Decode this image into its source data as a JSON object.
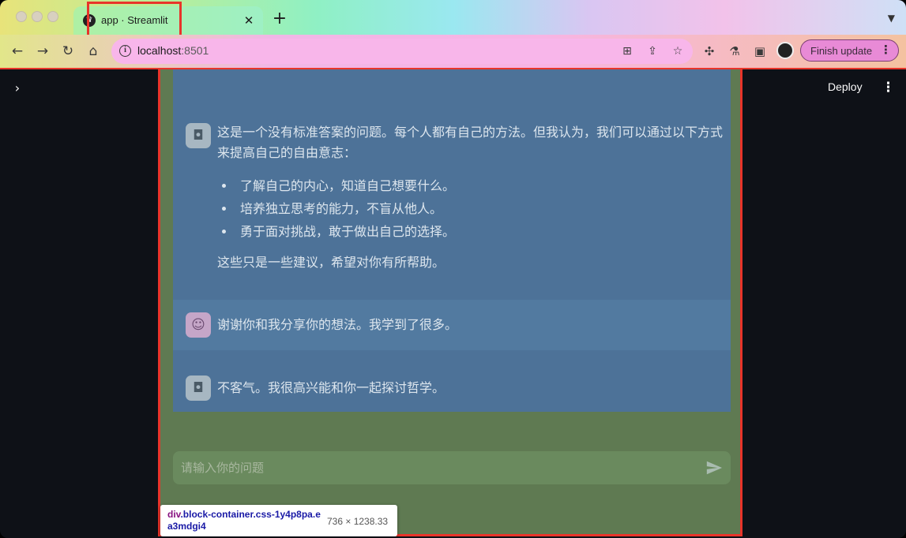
{
  "browser": {
    "tab_title": "app · Streamlit",
    "tab_close": "✕",
    "new_tab": "+",
    "url_host": "localhost",
    "url_port": ":8501",
    "finish_update_label": "Finish update"
  },
  "app": {
    "deploy_label": "Deploy",
    "messages": [
      {
        "role": "assistant",
        "intro": "这是一个没有标准答案的问题。每个人都有自己的方法。但我认为，我们可以通过以下方式来提高自己的自由意志：",
        "bullets": [
          "了解自己的内心，知道自己想要什么。",
          "培养独立思考的能力，不盲从他人。",
          "勇于面对挑战，敢于做出自己的选择。"
        ],
        "outro": "这些只是一些建议，希望对你有所帮助。"
      },
      {
        "role": "user",
        "text": "谢谢你和我分享你的想法。我学到了很多。"
      },
      {
        "role": "assistant",
        "text": "不客气。我很高兴能和你一起探讨哲学。"
      }
    ],
    "chat_input_placeholder": "请输入你的问题"
  },
  "inspector": {
    "tag": "div",
    "selector": ".block-container.css-1y4p8pa.ea3mdgi4",
    "size": "736 × 1238.33"
  },
  "colors": {
    "highlight": "#e8342a",
    "block_overlay": "#5f7a52",
    "chat_overlay": "#4d7298",
    "app_background": "#0e1117"
  },
  "icons": [
    "back-arrow-icon",
    "forward-arrow-icon",
    "reload-icon",
    "home-icon",
    "info-icon",
    "translate-icon",
    "share-icon",
    "star-icon",
    "extensions-icon",
    "labs-icon",
    "sidepanel-icon",
    "profile-icon",
    "kebab-menu-icon",
    "chevron-right-icon",
    "robot-icon",
    "face-icon",
    "send-icon"
  ]
}
